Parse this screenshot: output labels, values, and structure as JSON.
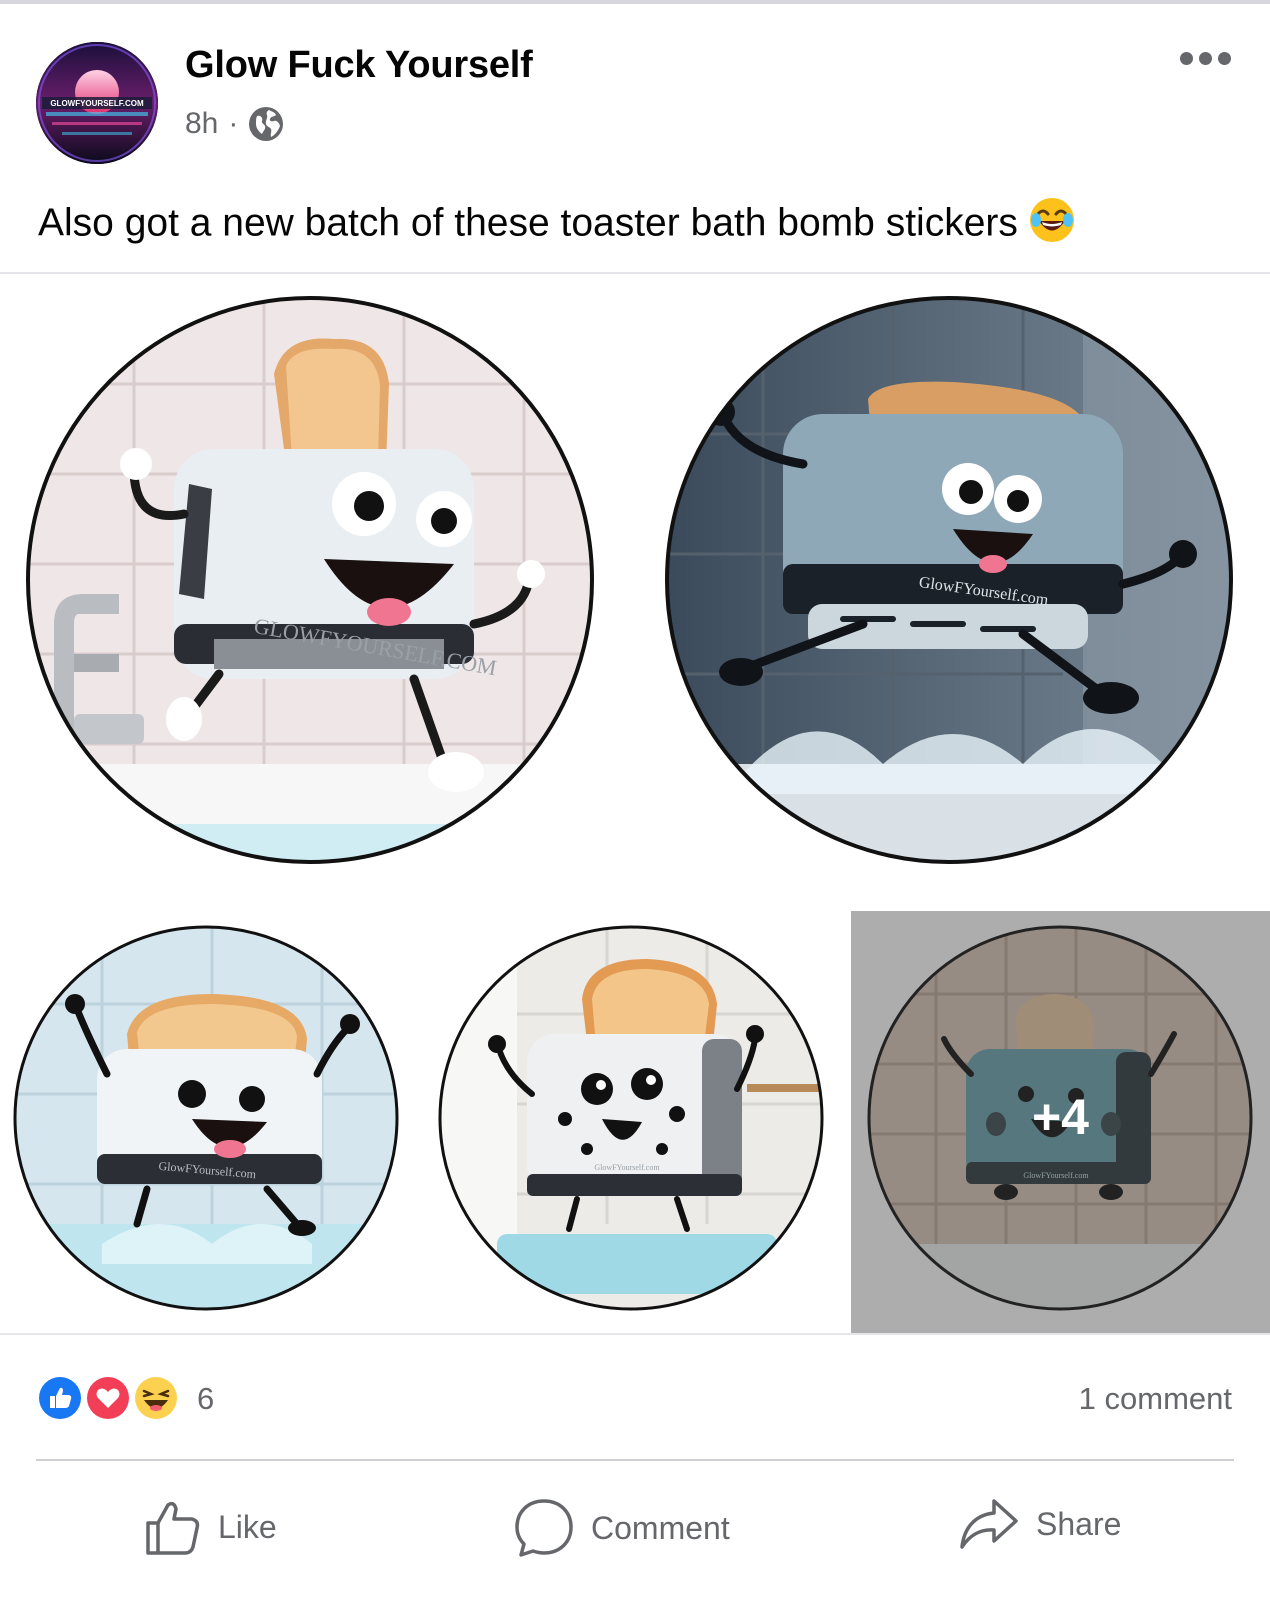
{
  "post": {
    "page_name": "Glow Fuck Yourself",
    "time": "8h",
    "separator": "·",
    "caption": "Also got a new batch of these toaster bath bomb stickers",
    "avatar_text": "GLOWFYOURSELF.COM"
  },
  "photos": {
    "watermarks": [
      "GLOWFYOURSELF.COM",
      "GlowFYourself.com",
      "GlowFYourself.com",
      "GlowFYourself.com",
      "GlowFYourself.com"
    ],
    "more_count": "+4"
  },
  "engagement": {
    "reaction_count": "6",
    "comments": "1 comment"
  },
  "actions": {
    "like": "Like",
    "comment": "Comment",
    "share": "Share"
  },
  "colors": {
    "like_blue": "#1877f2",
    "love_red": "#f33e58",
    "haha_yellow": "#fcd14f",
    "meta_gray": "#65676b"
  },
  "icons": [
    "globe-icon",
    "more-dots-icon",
    "laughing-emoji-icon",
    "like-reaction-icon",
    "love-reaction-icon",
    "haha-reaction-icon",
    "thumbs-up-icon",
    "comment-bubble-icon",
    "share-arrow-icon"
  ]
}
